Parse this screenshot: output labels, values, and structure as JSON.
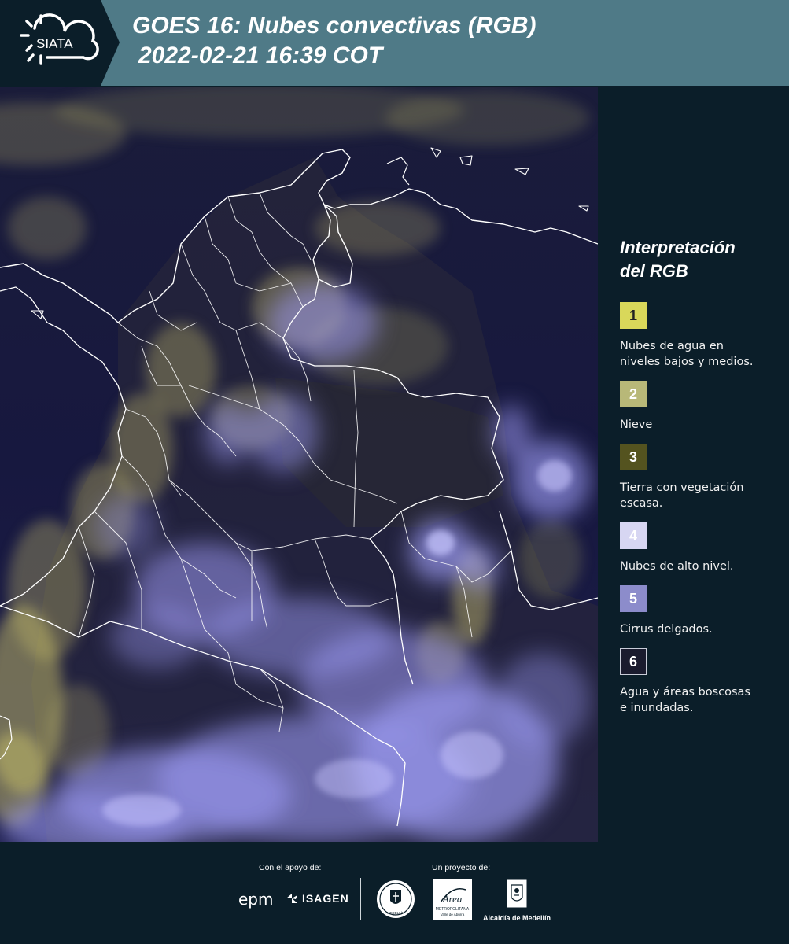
{
  "header": {
    "brand": "SIATA",
    "title_line1": "GOES 16: Nubes convectivas (RGB)",
    "title_line2": "2022-02-21 16:39 COT"
  },
  "legend": {
    "title_line1": "Interpretación",
    "title_line2": "del RGB",
    "items": [
      {
        "number": "1",
        "label_line1": "Nubes de agua en",
        "label_line2": "niveles bajos y medios.",
        "color": "#d9d85a",
        "text_color": "#222222"
      },
      {
        "number": "2",
        "label_line1": "Nieve",
        "label_line2": "",
        "color": "#b8b878",
        "text_color": "#ffffff"
      },
      {
        "number": "3",
        "label_line1": "Tierra con vegetación",
        "label_line2": "escasa.",
        "color": "#54531f",
        "text_color": "#ffffff"
      },
      {
        "number": "4",
        "label_line1": "Nubes de alto nivel.",
        "label_line2": "",
        "color": "#d7d6f2",
        "text_color": "#ffffff"
      },
      {
        "number": "5",
        "label_line1": "Cirrus delgados.",
        "label_line2": "",
        "color": "#8c8ccb",
        "text_color": "#ffffff"
      },
      {
        "number": "6",
        "label_line1": "Agua y áreas boscosas",
        "label_line2": "e inundadas.",
        "color": "#1a1b2e",
        "text_color": "#ffffff"
      }
    ]
  },
  "footer": {
    "support_label": "Con el apoyo de:",
    "project_label": "Un proyecto de:",
    "sponsor1": "epm",
    "sponsor2": "ISAGEN",
    "partner1": "MEDELLÍN",
    "partner2_line1": "Área",
    "partner2_line2": "METROPOLITANA",
    "partner2_line3": "Valle de Aburrá",
    "partner3": "Alcaldía de Medellín"
  },
  "colors": {
    "header_bg": "#4f7a87",
    "logo_bg": "#0b1e29",
    "page_bg": "#0b1e29",
    "map_bg": "#17193f",
    "low_cloud": "#c9c16a",
    "high_cloud": "#9a98f0"
  }
}
